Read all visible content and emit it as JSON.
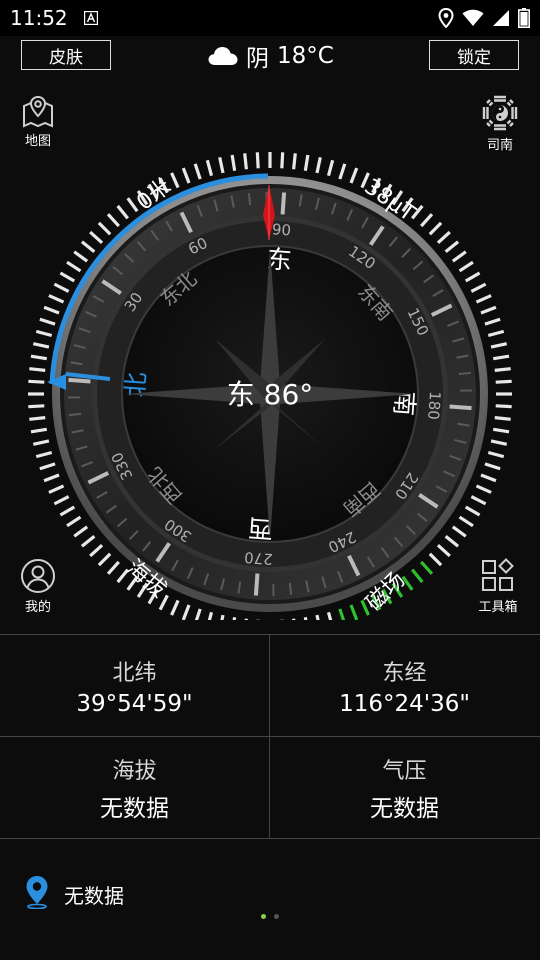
{
  "status": {
    "time": "11:52"
  },
  "header": {
    "skin_label": "皮肤",
    "lock_label": "锁定",
    "weather": {
      "condition": "阴",
      "temp": "18°C"
    }
  },
  "sidebar_left": {
    "map_label": "地图",
    "me_label": "我的"
  },
  "sidebar_right": {
    "sinan_label": "司南",
    "tools_label": "工具箱"
  },
  "compass": {
    "heading_text": "东 86°",
    "heading_degrees": 86,
    "altitude_arc_label": "0米",
    "magnetic_field_label": "38μT",
    "altitude_caption": "海拔",
    "magnetic_caption": "磁场",
    "directions": [
      "北",
      "东北",
      "东",
      "东南",
      "南",
      "西南",
      "西",
      "西北"
    ],
    "degree_labels": [
      "30",
      "60",
      "90",
      "120",
      "150",
      "180",
      "210",
      "240",
      "270",
      "300",
      "330"
    ]
  },
  "info": {
    "latitude": {
      "label": "北纬",
      "value": "39°54'59\""
    },
    "longitude": {
      "label": "东经",
      "value": "116°24'36\""
    },
    "altitude": {
      "label": "海拔",
      "value": "无数据"
    },
    "pressure": {
      "label": "气压",
      "value": "无数据"
    }
  },
  "location": {
    "text": "无数据"
  },
  "pager": {
    "active_index": 0,
    "count": 2
  },
  "colors": {
    "accent_blue": "#2b8fe0",
    "magnet_green": "#2fbf2f",
    "needle_red": "#d4141b",
    "pager_active": "#8bd048"
  }
}
